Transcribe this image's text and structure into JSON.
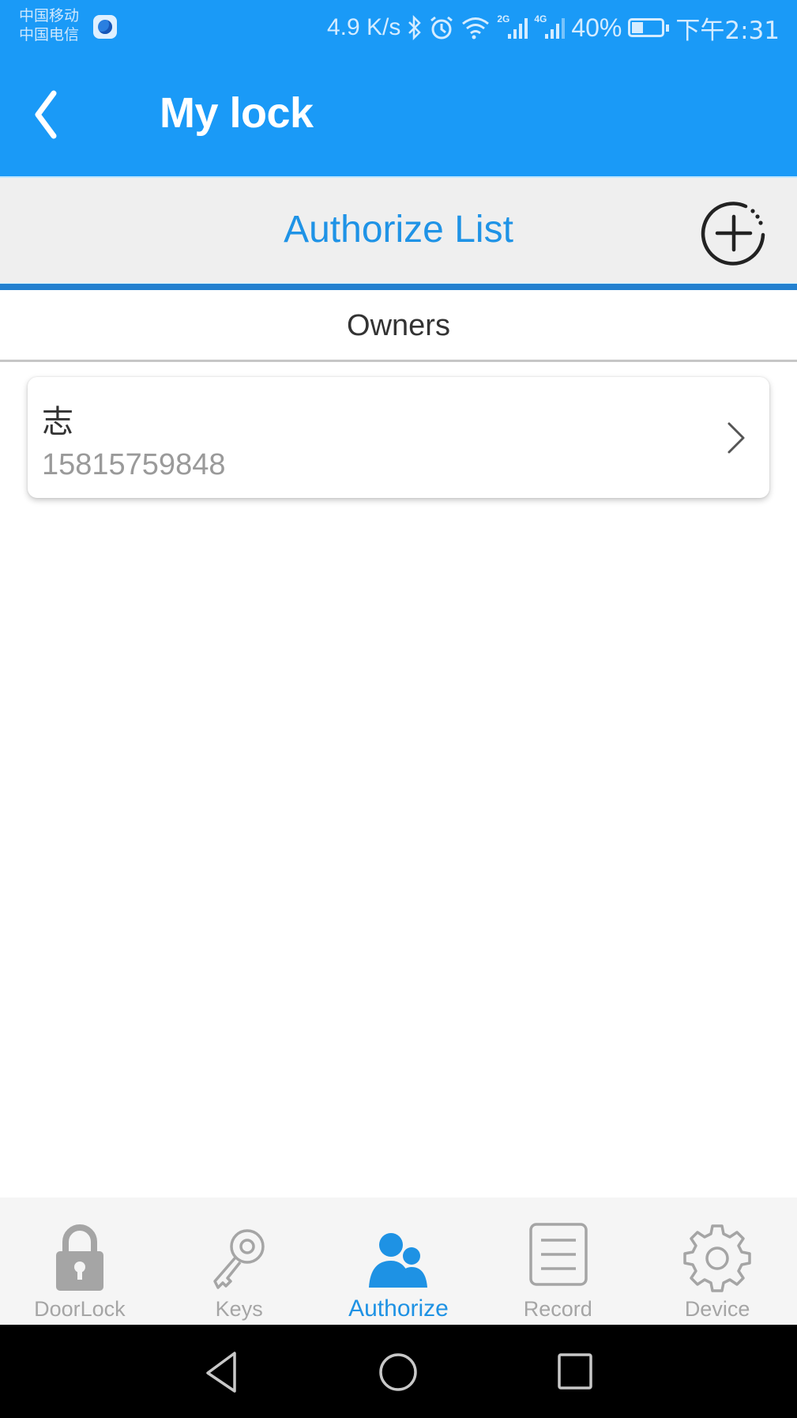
{
  "status_bar": {
    "carrier_1": "中国移动",
    "carrier_2": "中国电信",
    "net_speed": "4.9 K/s",
    "signal_1_type": "2G",
    "signal_2_type": "4G",
    "battery_percent": "40%",
    "time": "下午2:31",
    "icons": [
      "app-notification-icon",
      "bluetooth-icon",
      "alarm-icon",
      "wifi-icon",
      "signal-2g-icon",
      "signal-4g-icon",
      "battery-icon"
    ]
  },
  "app_bar": {
    "title": "My lock",
    "back_icon": "chevron-left-icon"
  },
  "section": {
    "title": "Authorize List",
    "add_icon": "add-circle-icon"
  },
  "owners": {
    "header": "Owners",
    "items": [
      {
        "name": "志",
        "phone": "15815759848"
      }
    ]
  },
  "tab_bar": {
    "active": "Authorize",
    "tabs": [
      {
        "label": "DoorLock",
        "icon": "lock-icon"
      },
      {
        "label": "Keys",
        "icon": "key-icon"
      },
      {
        "label": "Authorize",
        "icon": "users-icon"
      },
      {
        "label": "Record",
        "icon": "record-list-icon"
      },
      {
        "label": "Device",
        "icon": "gear-icon"
      }
    ]
  },
  "colors": {
    "primary": "#1a9af7",
    "accent_text": "#1f93e6",
    "rule": "#2380cf",
    "inactive_tab": "#a5a5a5"
  }
}
